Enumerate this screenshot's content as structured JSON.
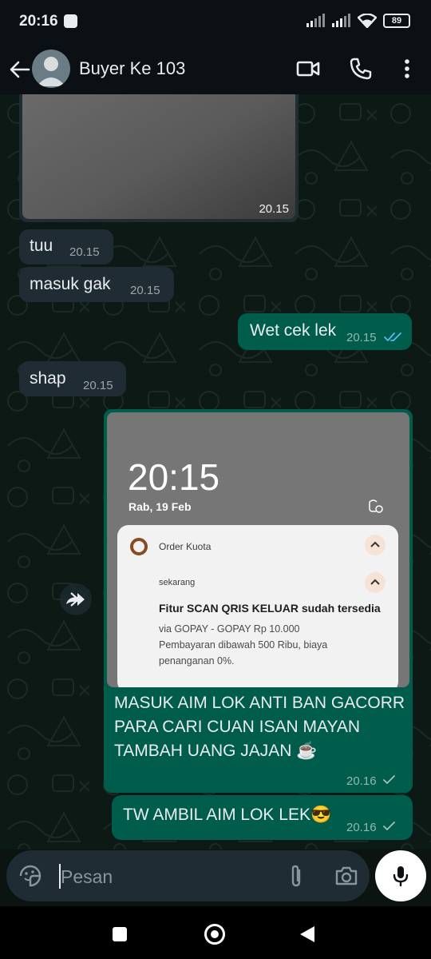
{
  "status_bar": {
    "time": "20:16",
    "battery": "89"
  },
  "header": {
    "contact_name": "Buyer Ke 103"
  },
  "image_message": {
    "time": "20.15"
  },
  "messages": [
    {
      "text": "tuu",
      "time": "20.15"
    },
    {
      "text": "masuk gak",
      "time": "20.15"
    },
    {
      "text": "Wet cek lek",
      "time": "20.15"
    },
    {
      "text": "shap",
      "time": "20.15"
    }
  ],
  "screenshot_message": {
    "lock_time": "20:15",
    "lock_date": "Rab, 19 Feb",
    "notification": {
      "app_name": "Order Kuota",
      "when": "sekarang",
      "title": "Fitur SCAN QRIS KELUAR sudah tersedia",
      "line1": "via GOPAY - GOPAY Rp 10.000",
      "line2": "Pembayaran dibawah 500 Ribu, biaya",
      "line3": "penanganan 0%."
    },
    "caption_line1": "MASUK AIM LOK ANTI BAN GACORR",
    "caption_line2": "PARA CARI CUAN ISAN MAYAN",
    "caption_line3": "TAMBAH UANG JAJAN ☕",
    "time": "20.16"
  },
  "last_message": {
    "text": "TW AMBIL AIM LOK LEK😎",
    "time": "20.16"
  },
  "composer": {
    "placeholder": "Pesan"
  },
  "icons": {
    "back": "arrow-left-icon",
    "video": "video-call-icon",
    "phone": "phone-icon",
    "menu": "more-vert-icon",
    "emoji": "sticker-icon",
    "attach": "paperclip-icon",
    "camera": "camera-icon",
    "mic": "microphone-icon",
    "forward": "forward-icon"
  },
  "colors": {
    "header_bg": "#0b1014",
    "chat_bg": "#0c1915",
    "incoming_bubble": "#202c33",
    "outgoing_bubble": "#005c4b",
    "read_tick": "#53bdeb"
  }
}
